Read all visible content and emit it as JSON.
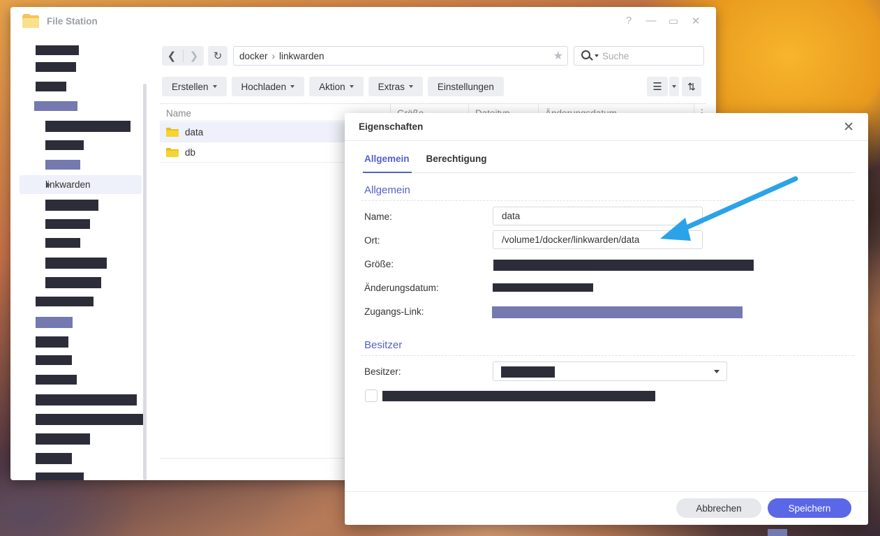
{
  "window": {
    "title": "File Station",
    "controls": [
      "?",
      "—",
      "▭",
      "✕"
    ]
  },
  "sidebar": {
    "selected_item": "linkwarden"
  },
  "toolbar": {
    "path": [
      "docker",
      "linkwarden"
    ],
    "search_placeholder": "Suche",
    "buttons": [
      "Erstellen",
      "Hochladen",
      "Aktion",
      "Extras",
      "Einstellungen"
    ]
  },
  "file_list": {
    "columns": [
      "Name",
      "Größe",
      "Dateityp",
      "Änderungsdatum"
    ],
    "rows": [
      "data",
      "db"
    ]
  },
  "dialog": {
    "title": "Eigenschaften",
    "tabs": [
      "Allgemein",
      "Berechtigung"
    ],
    "section_general": "Allgemein",
    "labels": {
      "name": "Name:",
      "location": "Ort:",
      "size": "Größe:",
      "modified": "Änderungsdatum:",
      "access_link": "Zugangs-Link:"
    },
    "values": {
      "name": "data",
      "location": "/volume1/docker/linkwarden/data"
    },
    "section_owner": "Besitzer",
    "owner_label": "Besitzer:",
    "cancel_label": "Abbrechen",
    "save_label": "Speichern"
  },
  "colors": {
    "accent": "#5562c9",
    "save_button": "#5a67e6",
    "annotation_arrow": "#2aa3e8"
  }
}
